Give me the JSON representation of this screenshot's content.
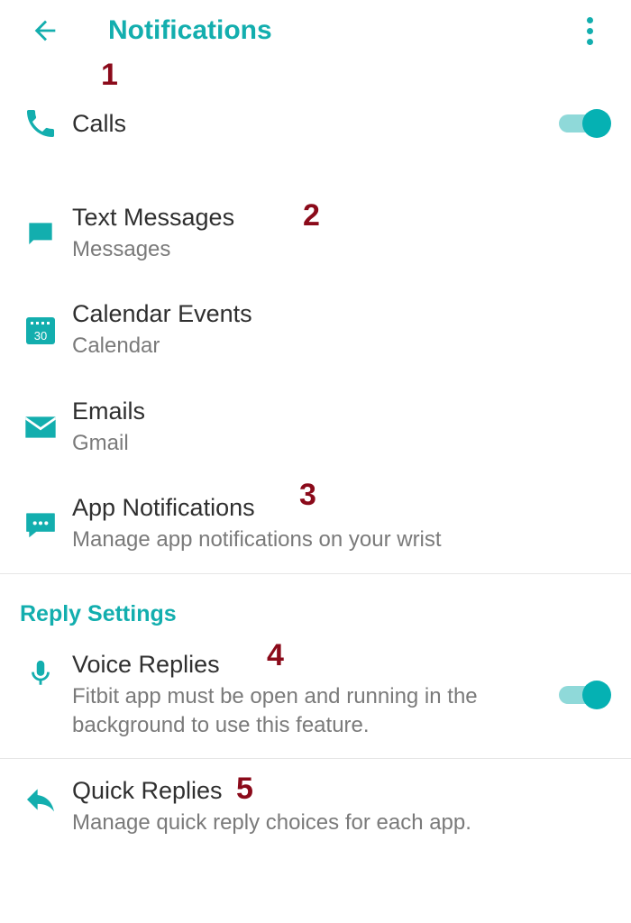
{
  "colors": {
    "accent": "#13aeae",
    "text": "#2f2f2f",
    "sub": "#7a7a7a",
    "annot": "#8b0a1a"
  },
  "header": {
    "title": "Notifications"
  },
  "items": {
    "calls": {
      "label": "Calls",
      "toggle_on": true
    },
    "texts": {
      "label": "Text Messages",
      "sub": "Messages"
    },
    "calendar": {
      "label": "Calendar Events",
      "sub": "Calendar",
      "icon_day": "30"
    },
    "emails": {
      "label": "Emails",
      "sub": "Gmail"
    },
    "apps": {
      "label": "App Notifications",
      "sub": "Manage app notifications on your wrist"
    }
  },
  "reply_section": {
    "title": "Reply Settings"
  },
  "replies": {
    "voice": {
      "label": "Voice Replies",
      "sub": "Fitbit app must be open and running in the background to use this feature.",
      "toggle_on": true
    },
    "quick": {
      "label": "Quick Replies",
      "sub": "Manage quick reply choices for each app."
    }
  },
  "annotations": {
    "a1": "1",
    "a2": "2",
    "a3": "3",
    "a4": "4",
    "a5": "5"
  }
}
